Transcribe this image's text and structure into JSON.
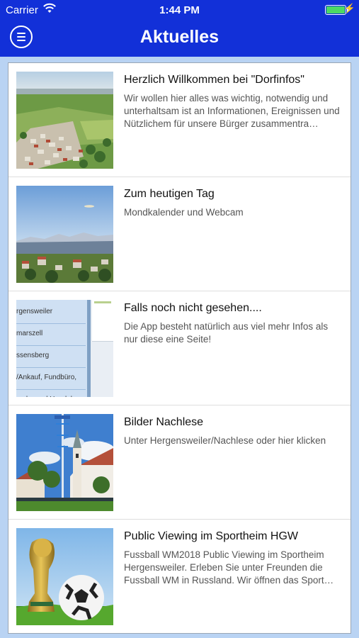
{
  "status_bar": {
    "carrier": "Carrier",
    "time": "1:44 PM"
  },
  "header": {
    "title": "Aktuelles",
    "menu_icon": "hamburger-menu-icon"
  },
  "items": [
    {
      "title": "Herzlich Willkommen bei \"Dorfinfos\"",
      "text": "Wir wollen hier alles was wichtig, notwendig und unterhaltsam ist an Informationen, Ereignissen und Nützlichem für unsere Bürger zusammentra…"
    },
    {
      "title": "Zum heutigen Tag",
      "text": "Mondkalender und Webcam"
    },
    {
      "title": "Falls noch nicht gesehen....",
      "text": "Die App besteht natürlich aus viel mehr Infos als nur diese eine Seite!",
      "thumb_menu": [
        "rgensweiler",
        "marszell",
        "ssensberg",
        "/Ankauf, Fundbüro,",
        "verbe und Handel"
      ]
    },
    {
      "title": "Bilder Nachlese",
      "text": "Unter Hergensweiler/Nachlese oder hier klicken"
    },
    {
      "title": "Public Viewing im Sportheim HGW",
      "text": "Fussball WM2018 Public Viewing im Sportheim Hergensweiler. Erleben Sie unter Freunden die Fussball WM in Russland. Wir öffnen das Sport…"
    }
  ]
}
